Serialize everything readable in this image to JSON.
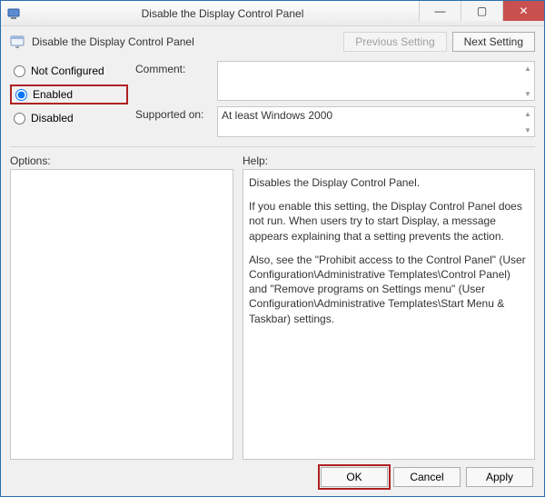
{
  "window": {
    "title": "Disable the Display Control Panel",
    "minimize_glyph": "—",
    "maximize_glyph": "▢",
    "close_glyph": "✕"
  },
  "header": {
    "policy_name": "Disable the Display Control Panel",
    "previous_label": "Previous Setting",
    "next_label": "Next Setting"
  },
  "radios": {
    "not_configured": "Not Configured",
    "enabled": "Enabled",
    "disabled": "Disabled",
    "selected": "enabled"
  },
  "fields": {
    "comment_label": "Comment:",
    "comment_value": "",
    "supported_label": "Supported on:",
    "supported_value": "At least Windows 2000"
  },
  "lower": {
    "options_label": "Options:",
    "help_label": "Help:"
  },
  "help": {
    "p1": "Disables the Display Control Panel.",
    "p2": "If you enable this setting, the Display Control Panel does not run. When users try to start Display, a message appears explaining that a setting prevents the action.",
    "p3": "Also, see the \"Prohibit access to the Control Panel\" (User Configuration\\Administrative Templates\\Control Panel) and \"Remove programs on Settings menu\" (User Configuration\\Administrative Templates\\Start Menu & Taskbar) settings."
  },
  "footer": {
    "ok": "OK",
    "cancel": "Cancel",
    "apply": "Apply"
  }
}
